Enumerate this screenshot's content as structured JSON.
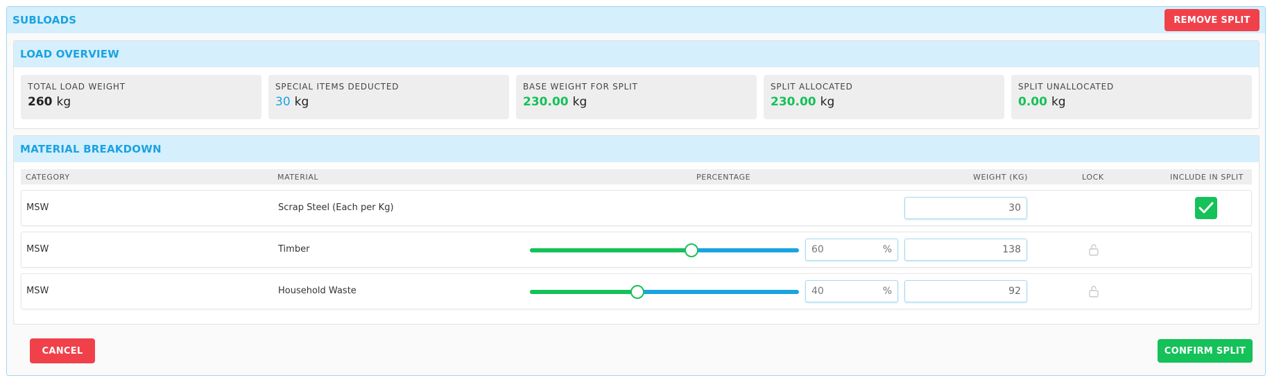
{
  "header": {
    "title": "SUBLOADS",
    "remove_split_label": "REMOVE SPLIT"
  },
  "overview": {
    "title": "LOAD OVERVIEW",
    "cards": [
      {
        "label": "TOTAL LOAD WEIGHT",
        "value": "260",
        "unit": "kg",
        "value_color": "#222222"
      },
      {
        "label": "SPECIAL ITEMS DEDUCTED",
        "value": "30",
        "unit": "kg",
        "value_color": "#1aa3e2"
      },
      {
        "label": "BASE WEIGHT FOR SPLIT",
        "value": "230.00",
        "unit": "kg",
        "value_color": "#15c159"
      },
      {
        "label": "SPLIT ALLOCATED",
        "value": "230.00",
        "unit": "kg",
        "value_color": "#15c159"
      },
      {
        "label": "SPLIT UNALLOCATED",
        "value": "0.00",
        "unit": "kg",
        "value_color": "#15c159"
      }
    ]
  },
  "breakdown": {
    "title": "MATERIAL BREAKDOWN",
    "columns": {
      "category": "CATEGORY",
      "material": "MATERIAL",
      "percentage": "PERCENTAGE",
      "weight": "WEIGHT (KG)",
      "lock": "LOCK",
      "include": "INCLUDE IN SPLIT"
    },
    "rows": [
      {
        "category": "MSW",
        "material": "Scrap Steel (Each per Kg)",
        "weight": "30",
        "include_checked": true
      },
      {
        "category": "MSW",
        "material": "Timber",
        "percentage": "60",
        "percent_sign": "%",
        "slider_level": 0.6,
        "weight": "138",
        "lock_icon": "unlock-icon"
      },
      {
        "category": "MSW",
        "material": "Household Waste",
        "percentage": "40",
        "percent_sign": "%",
        "slider_level": 0.4,
        "weight": "92",
        "lock_icon": "unlock-icon"
      }
    ]
  },
  "footer": {
    "cancel_label": "CANCEL",
    "confirm_label": "CONFIRM SPLIT"
  },
  "colors": {
    "accent_blue": "#1aa3e2",
    "green": "#15c159",
    "red": "#f0414b",
    "header_bg": "#d6effc"
  }
}
